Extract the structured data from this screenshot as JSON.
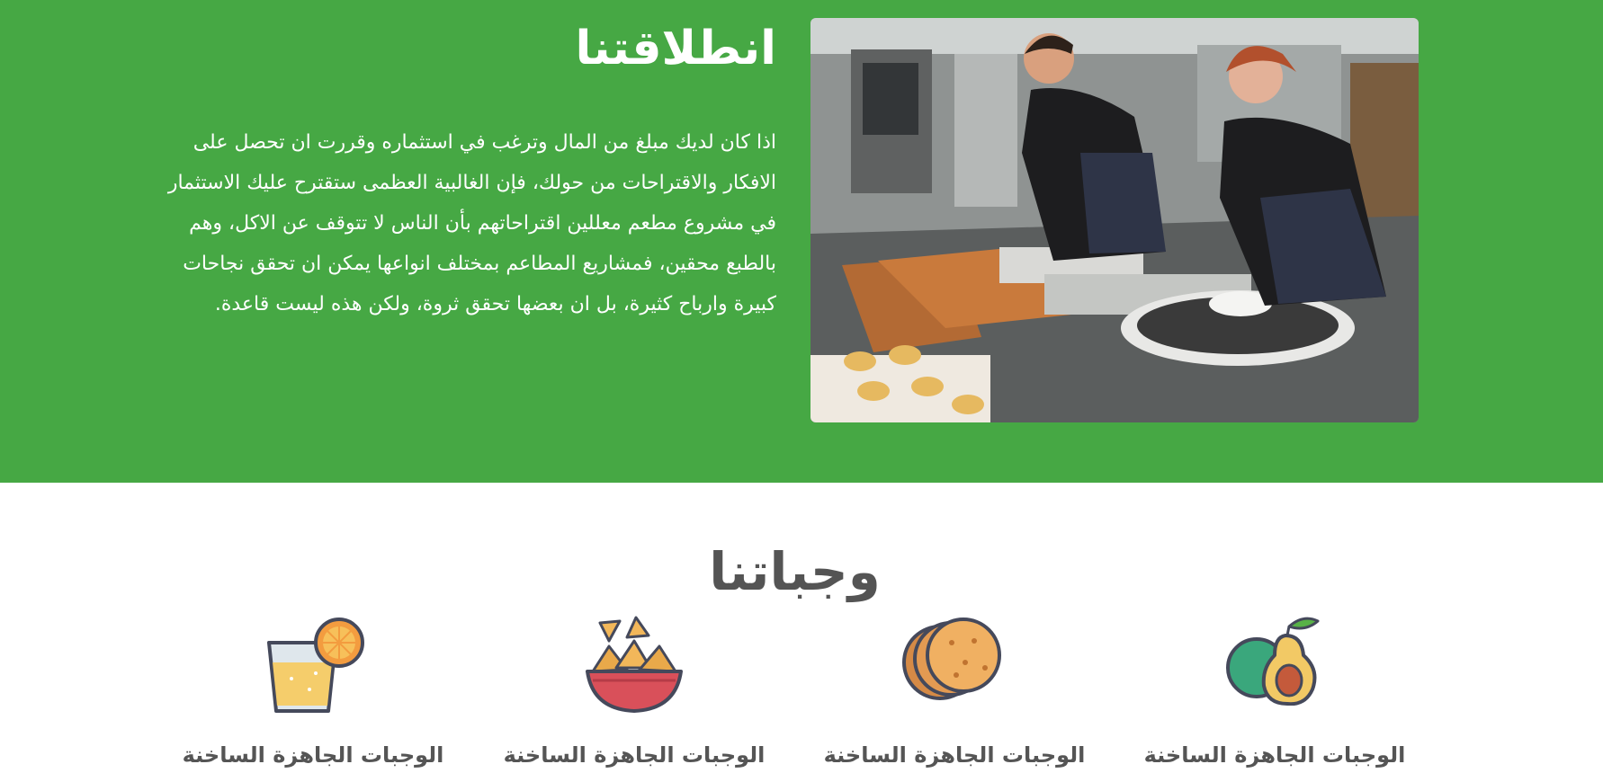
{
  "about": {
    "title": "انطلاقتنا",
    "paragraph": "اذا كان لديك مبلغ من المال وترغب في استثماره وقررت ان تحصل على الافكار والاقتراحات من حولك، فإن الغالبية العظمى ستقترح عليك الاستثمار في مشروع مطعم معللين اقتراحاتهم بأن الناس لا تتوقف عن الاكل، وهم بالطبع محقين، فمشاريع المطاعم بمختلف انواعها يمكن ان تحقق نجاحات كبيرة وارباح كثيرة، بل ان بعضها تحقق ثروة، ولكن هذه ليست قاعدة.",
    "image": "chefs-in-kitchen-photo"
  },
  "meals": {
    "title": "وجباتنا",
    "items": [
      {
        "icon": "avocado-icon",
        "label": "الوجبات الجاهزة الساخنة"
      },
      {
        "icon": "tortilla-icon",
        "label": "الوجبات الجاهزة الساخنة"
      },
      {
        "icon": "nachos-bowl-icon",
        "label": "الوجبات الجاهزة الساخنة"
      },
      {
        "icon": "juice-glass-icon",
        "label": "الوجبات الجاهزة الساخنة"
      }
    ]
  },
  "colors": {
    "brand_green": "#46a844",
    "heading_gray": "#545454"
  }
}
